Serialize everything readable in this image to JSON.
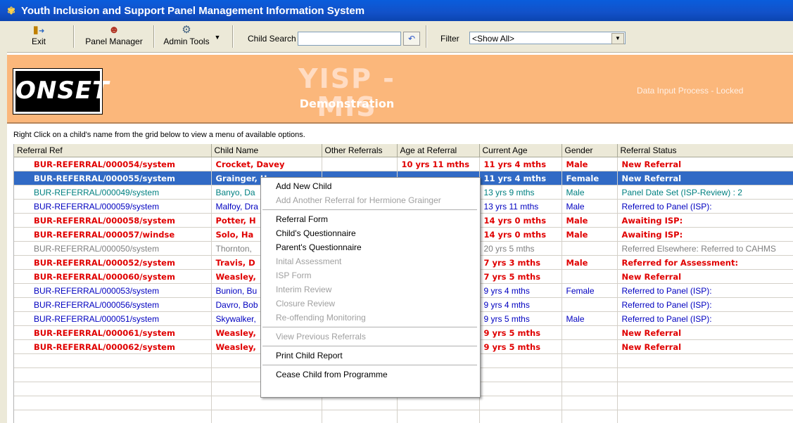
{
  "window": {
    "title": "Youth Inclusion and Support Panel Management Information System"
  },
  "toolbar": {
    "exit_label": "Exit",
    "panel_manager_label": "Panel Manager",
    "admin_tools_label": "Admin Tools",
    "child_search_label": "Child Search",
    "child_search_value": "",
    "filter_label": "Filter",
    "filter_value": "<Show All>"
  },
  "banner": {
    "logo_text": "ONSET",
    "title": "YISP - MIS",
    "subtitle": "Demonstration",
    "status": "Data Input Process - Locked",
    "color": "#fbb77b"
  },
  "instructions": "Right Click on a child's name from the grid below to view a menu of available options.",
  "grid": {
    "columns": [
      "Referral Ref",
      "Child Name",
      "Other Referrals",
      "Age at Referral",
      "Current Age",
      "Gender",
      "Referral Status"
    ],
    "rows": [
      {
        "style": "red",
        "ref": "BUR-REFERRAL/000054/system",
        "name": "Crocket, Davey",
        "other": "",
        "age_ref": "10 yrs 11 mths",
        "age_cur": "11 yrs 4 mths",
        "gender": "Male",
        "status": "New Referral"
      },
      {
        "style": "sel",
        "ref": "BUR-REFERRAL/000055/system",
        "name": "Grainger, H",
        "other": "",
        "age_ref": "",
        "age_cur": "11 yrs 4 mths",
        "gender": "Female",
        "status": "New Referral"
      },
      {
        "style": "teal",
        "ref": "BUR-REFERRAL/000049/system",
        "name": "Banyo, Da",
        "other": "",
        "age_ref": "",
        "age_cur": "13 yrs 9 mths",
        "gender": "Male",
        "status": "Panel Date Set (ISP-Review) : 2"
      },
      {
        "style": "blue",
        "ref": "BUR-REFERRAL/000059/system",
        "name": "Malfoy, Dra",
        "other": "",
        "age_ref": "",
        "age_cur": "13 yrs 11 mths",
        "gender": "Male",
        "status": "Referred to Panel (ISP):"
      },
      {
        "style": "red",
        "ref": "BUR-REFERRAL/000058/system",
        "name": "Potter, H",
        "other": "",
        "age_ref": "",
        "age_cur": "14 yrs 0 mths",
        "gender": "Male",
        "status": "Awaiting ISP:"
      },
      {
        "style": "red",
        "ref": "BUR-REFERRAL/000057/windse",
        "name": "Solo, Ha",
        "other": "",
        "age_ref": "",
        "age_cur": "14 yrs 0 mths",
        "gender": "Male",
        "status": "Awaiting ISP:"
      },
      {
        "style": "gray",
        "ref": "BUR-REFERRAL/000050/system",
        "name": "Thornton,",
        "other": "",
        "age_ref": "",
        "age_cur": "20 yrs 5 mths",
        "gender": "",
        "status": "Referred Elsewhere: Referred to CAHMS"
      },
      {
        "style": "red",
        "ref": "BUR-REFERRAL/000052/system",
        "name": "Travis, D",
        "other": "",
        "age_ref": "",
        "age_cur": "7 yrs 3 mths",
        "gender": "Male",
        "status": "Referred for Assessment:"
      },
      {
        "style": "red",
        "ref": "BUR-REFERRAL/000060/system",
        "name": "Weasley,",
        "other": "",
        "age_ref": "",
        "age_cur": "7 yrs 5 mths",
        "gender": "",
        "status": "New Referral"
      },
      {
        "style": "blue",
        "ref": "BUR-REFERRAL/000053/system",
        "name": "Bunion, Bu",
        "other": "",
        "age_ref": "",
        "age_cur": "9 yrs 4 mths",
        "gender": "Female",
        "status": "Referred to Panel (ISP):"
      },
      {
        "style": "blue",
        "ref": "BUR-REFERRAL/000056/system",
        "name": "Davro, Bob",
        "other": "",
        "age_ref": "",
        "age_cur": "9 yrs 4 mths",
        "gender": "",
        "status": "Referred to Panel (ISP):"
      },
      {
        "style": "blue",
        "ref": "BUR-REFERRAL/000051/system",
        "name": "Skywalker,",
        "other": "",
        "age_ref": "",
        "age_cur": "9 yrs 5 mths",
        "gender": "Male",
        "status": "Referred to Panel (ISP):"
      },
      {
        "style": "red",
        "ref": "BUR-REFERRAL/000061/system",
        "name": "Weasley,",
        "other": "",
        "age_ref": "",
        "age_cur": "9 yrs 5 mths",
        "gender": "",
        "status": "New Referral"
      },
      {
        "style": "red",
        "ref": "BUR-REFERRAL/000062/system",
        "name": "Weasley,",
        "other": "",
        "age_ref": "",
        "age_cur": "9 yrs 5 mths",
        "gender": "",
        "status": "New Referral"
      }
    ]
  },
  "context_menu": {
    "items": [
      {
        "label": "Add New Child",
        "disabled": false
      },
      {
        "label": "Add Another Referral for Hermione  Grainger",
        "disabled": true
      },
      {
        "sep": true
      },
      {
        "label": "Referral Form",
        "disabled": false
      },
      {
        "label": "Child's Questionnaire",
        "disabled": false
      },
      {
        "label": "Parent's Questionnaire",
        "disabled": false
      },
      {
        "label": "Inital Assessment",
        "disabled": true
      },
      {
        "label": "ISP Form",
        "disabled": true
      },
      {
        "label": "Interim Review",
        "disabled": true
      },
      {
        "label": "Closure Review",
        "disabled": true
      },
      {
        "label": "Re-offending Monitoring",
        "disabled": true
      },
      {
        "sep": true
      },
      {
        "label": "View Previous Referrals",
        "disabled": true
      },
      {
        "sep": true
      },
      {
        "label": "Print Child Report",
        "disabled": false
      },
      {
        "sep": true
      },
      {
        "label": "Cease Child from Programme",
        "disabled": false
      }
    ]
  }
}
